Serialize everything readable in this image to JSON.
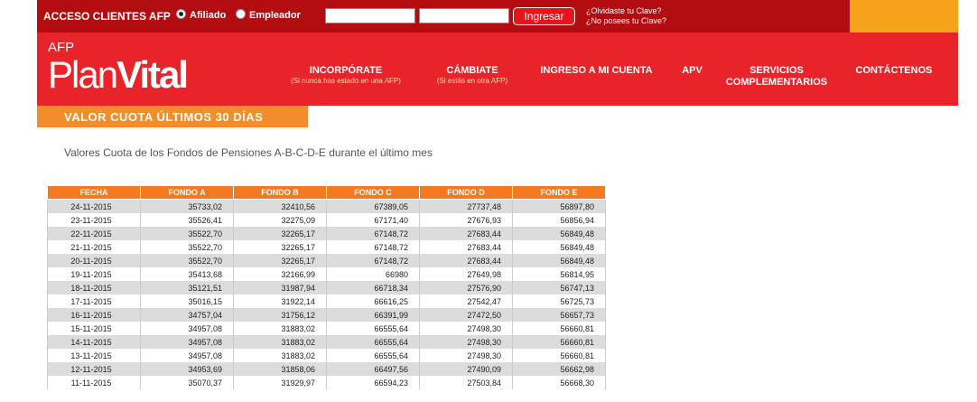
{
  "login": {
    "title": "ACCESO CLIENTES AFP",
    "radio_afiliado": "Afiliado",
    "radio_empleador": "Empleador",
    "user_value": "",
    "password_value": "",
    "submit_label": "Ingresar",
    "forgot_password": "¿Olvidaste tu Clave?",
    "no_password": "¿No posees tu Clave?"
  },
  "logo": {
    "prefix": "AFP",
    "name_plan": "Plan",
    "name_vital": "Vital"
  },
  "nav": [
    {
      "label": "INCORPÓRATE",
      "sub": "(Si nunca has estado en una AFP)"
    },
    {
      "label": "CÁMBIATE",
      "sub": "(Si estás en otra AFP)"
    },
    {
      "label": "INGRESO A MI CUENTA",
      "sub": ""
    },
    {
      "label": "APV",
      "sub": ""
    },
    {
      "label": "SERVICIOS COMPLEMENTARIOS",
      "sub": ""
    },
    {
      "label": "CONTÁCTENOS",
      "sub": ""
    }
  ],
  "section_title": "VALOR CUOTA ÚLTIMOS 30 DÍAS",
  "description": "Valores Cuota de los Fondos de Pensiones A-B-C-D-E durante el último mes",
  "table": {
    "headers": [
      "FECHA",
      "FONDO A",
      "FONDO B",
      "FONDO C",
      "FONDO D",
      "FONDO E"
    ],
    "rows": [
      [
        "24-11-2015",
        "35733,02",
        "32410,56",
        "67389,05",
        "27737,48",
        "56897,80"
      ],
      [
        "23-11-2015",
        "35526,41",
        "32275,09",
        "67171,40",
        "27676,93",
        "56856,94"
      ],
      [
        "22-11-2015",
        "35522,70",
        "32265,17",
        "67148,72",
        "27683,44",
        "56849,48"
      ],
      [
        "21-11-2015",
        "35522,70",
        "32265,17",
        "67148,72",
        "27683,44",
        "56849,48"
      ],
      [
        "20-11-2015",
        "35522,70",
        "32265,17",
        "67148,72",
        "27683,44",
        "56849,48"
      ],
      [
        "19-11-2015",
        "35413,68",
        "32166,99",
        "66980",
        "27649,98",
        "56814,95"
      ],
      [
        "18-11-2015",
        "35121,51",
        "31987,94",
        "66718,34",
        "27576,90",
        "56747,13"
      ],
      [
        "17-11-2015",
        "35016,15",
        "31922,14",
        "66616,25",
        "27542,47",
        "56725,73"
      ],
      [
        "16-11-2015",
        "34757,04",
        "31756,12",
        "66391,99",
        "27472,50",
        "56657,73"
      ],
      [
        "15-11-2015",
        "34957,08",
        "31883,02",
        "66555,64",
        "27498,30",
        "56660,81"
      ],
      [
        "14-11-2015",
        "34957,08",
        "31883,02",
        "66555,64",
        "27498,30",
        "56660,81"
      ],
      [
        "13-11-2015",
        "34957,08",
        "31883,02",
        "66555,64",
        "27498,30",
        "56660,81"
      ],
      [
        "12-11-2015",
        "34953,69",
        "31858,06",
        "66497,56",
        "27490,09",
        "56662,98"
      ],
      [
        "11-11-2015",
        "35070,37",
        "31929,97",
        "66594,23",
        "27503,84",
        "56668,30"
      ]
    ]
  }
}
